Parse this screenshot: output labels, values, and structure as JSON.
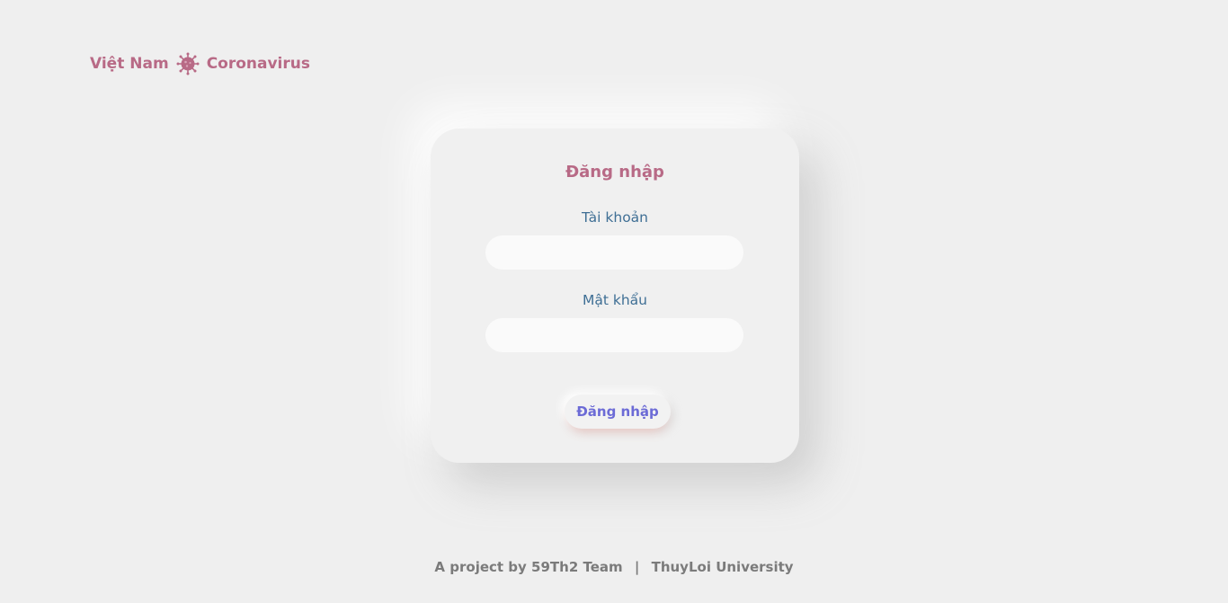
{
  "brand": {
    "left_text": "Việt Nam",
    "right_text": "Coronavirus",
    "icon": "virus-icon",
    "color": "#b86a86"
  },
  "login": {
    "title": "Đăng nhập",
    "username_label": "Tài khoản",
    "username_value": "",
    "password_label": "Mật khẩu",
    "password_value": "",
    "submit_label": "Đăng nhập",
    "title_color": "#b86a86",
    "label_color": "#3f6f95",
    "button_text_color": "#6c6bd6"
  },
  "footer": {
    "project_text": "A project by 59Th2 Team",
    "separator": "|",
    "university": "ThuyLoi University"
  }
}
